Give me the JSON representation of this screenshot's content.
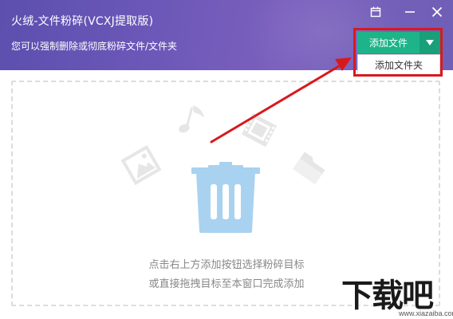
{
  "window": {
    "title": "火绒-文件粉碎(VCXJ提取版)",
    "subtitle": "您可以强制删除或彻底粉碎文件/文件夹",
    "icons": [
      "calendar-icon",
      "minimize-icon",
      "close-icon"
    ]
  },
  "toolbar": {
    "add_file_label": "添加文件",
    "dropdown_icon": "triangle-down-icon",
    "menu_items": [
      "添加文件夹"
    ],
    "accent_color": "#1fb389"
  },
  "dropzone": {
    "hint_line1": "点击右上方添加按钮选择粉碎目标",
    "hint_line2": "或直接拖拽目标至本窗口完成添加",
    "icons": [
      "music-note-icon",
      "film-icon",
      "image-icon",
      "folder-icon",
      "trash-icon"
    ]
  },
  "annotation": {
    "highlight_color": "#d8191c"
  },
  "watermark": {
    "text": "下载吧",
    "url": "www.xiazaiba.com"
  }
}
